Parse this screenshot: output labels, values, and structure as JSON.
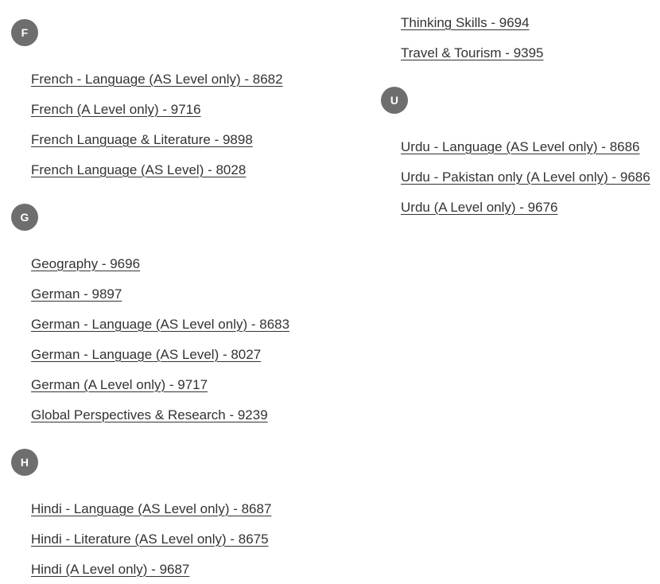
{
  "page": {
    "title": "Subject index",
    "background_color": "#ffffff",
    "link_color": "#333333",
    "badge_color": "#6e6e6e",
    "badge_text_color": "#ffffff"
  },
  "columns": [
    {
      "id": "left",
      "groups": [
        {
          "letter": "F",
          "badge_name": "letter-badge-f",
          "subjects": [
            {
              "label": "French - Language (AS Level only) - 8682",
              "name": "French - Language (AS Level only)",
              "code": "8682"
            },
            {
              "label": "French (A Level only) - 9716",
              "name": "French (A Level only)",
              "code": "9716"
            },
            {
              "label": "French Language & Literature - 9898",
              "name": "French Language & Literature",
              "code": "9898"
            },
            {
              "label": "French Language (AS Level) - 8028",
              "name": "French Language (AS Level)",
              "code": "8028"
            }
          ]
        },
        {
          "letter": "G",
          "badge_name": "letter-badge-g",
          "subjects": [
            {
              "label": "Geography - 9696",
              "name": "Geography",
              "code": "9696"
            },
            {
              "label": "German - 9897",
              "name": "German",
              "code": "9897"
            },
            {
              "label": "German - Language (AS Level only) - 8683",
              "name": "German - Language (AS Level only)",
              "code": "8683"
            },
            {
              "label": "German - Language (AS Level) - 8027",
              "name": "German - Language (AS Level)",
              "code": "8027"
            },
            {
              "label": "German (A Level only) - 9717",
              "name": "German (A Level only)",
              "code": "9717"
            },
            {
              "label": "Global Perspectives & Research - 9239",
              "name": "Global Perspectives & Research",
              "code": "9239"
            }
          ]
        },
        {
          "letter": "H",
          "badge_name": "letter-badge-h",
          "subjects": [
            {
              "label": "Hindi - Language (AS Level only) - 8687",
              "name": "Hindi - Language (AS Level only)",
              "code": "8687"
            },
            {
              "label": "Hindi - Literature (AS Level only) - 8675",
              "name": "Hindi - Literature (AS Level only)",
              "code": "8675"
            },
            {
              "label": "Hindi (A Level only) - 9687",
              "name": "Hindi (A Level only)",
              "code": "9687"
            }
          ]
        }
      ]
    },
    {
      "id": "right",
      "continued_subjects": [
        {
          "label": "Thinking Skills - 9694",
          "name": "Thinking Skills",
          "code": "9694"
        },
        {
          "label": "Travel & Tourism - 9395",
          "name": "Travel & Tourism",
          "code": "9395"
        }
      ],
      "groups": [
        {
          "letter": "U",
          "badge_name": "letter-badge-u",
          "subjects": [
            {
              "label": "Urdu - Language (AS Level only) - 8686",
              "name": "Urdu - Language (AS Level only)",
              "code": "8686"
            },
            {
              "label": "Urdu - Pakistan only (A Level only) - 9686",
              "name": "Urdu - Pakistan only (A Level only)",
              "code": "9686"
            },
            {
              "label": "Urdu (A Level only) - 9676",
              "name": "Urdu (A Level only)",
              "code": "9676"
            }
          ]
        }
      ]
    }
  ]
}
